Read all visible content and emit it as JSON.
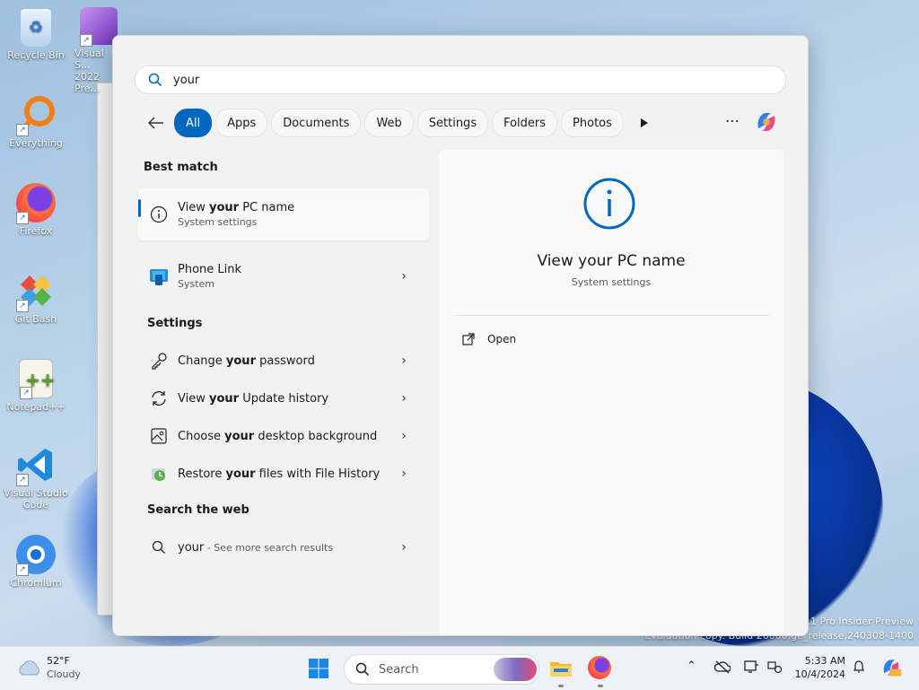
{
  "desktop": {
    "icons": [
      {
        "label": "Recycle Bin",
        "name": "recycle-bin-icon"
      },
      {
        "label": "Visual S… 2022 Pre…",
        "name": "visual-studio-icon"
      },
      {
        "label": "Everything",
        "name": "everything-icon"
      },
      {
        "label": "Firefox",
        "name": "firefox-icon"
      },
      {
        "label": "Git Bash",
        "name": "git-bash-icon"
      },
      {
        "label": "Notepad++",
        "name": "notepad-plus-plus-icon"
      },
      {
        "label": "Visual Studio Code",
        "name": "vscode-icon"
      },
      {
        "label": "Chromium",
        "name": "chromium-icon"
      }
    ],
    "watermark_line1": "11 Pro Insider Preview",
    "watermark_line2": "Evaluation copy. Build 26000.ge_release.240308-1400"
  },
  "search": {
    "query": "your",
    "filters": [
      "All",
      "Apps",
      "Documents",
      "Web",
      "Settings",
      "Folders",
      "Photos"
    ],
    "active_filter": "All",
    "best_match_header": "Best match",
    "best_match": {
      "pre": "View ",
      "bold": "your",
      "post": " PC name",
      "sub": "System settings"
    },
    "phone_link": {
      "title": "Phone Link",
      "sub": "System"
    },
    "settings_header": "Settings",
    "settings_items": [
      {
        "pre": "Change ",
        "bold": "your",
        "post": " password",
        "icon": "key-icon"
      },
      {
        "pre": "View ",
        "bold": "your",
        "post": " Update history",
        "icon": "refresh-icon"
      },
      {
        "pre": "Choose ",
        "bold": "your",
        "post": " desktop background",
        "icon": "image-icon"
      },
      {
        "pre": "Restore ",
        "bold": "your",
        "post": " files with File History",
        "icon": "file-history-icon"
      }
    ],
    "web_header": "Search the web",
    "web_item": {
      "query": "your",
      "suffix": " - See more search results"
    },
    "preview": {
      "title": "View your PC name",
      "subtitle": "System settings",
      "action": "Open"
    }
  },
  "taskbar": {
    "temperature": "52°F",
    "condition": "Cloudy",
    "search_label": "Search",
    "time": "5:33 AM",
    "date": "10/4/2024"
  },
  "colors": {
    "accent": "#0067c0"
  }
}
